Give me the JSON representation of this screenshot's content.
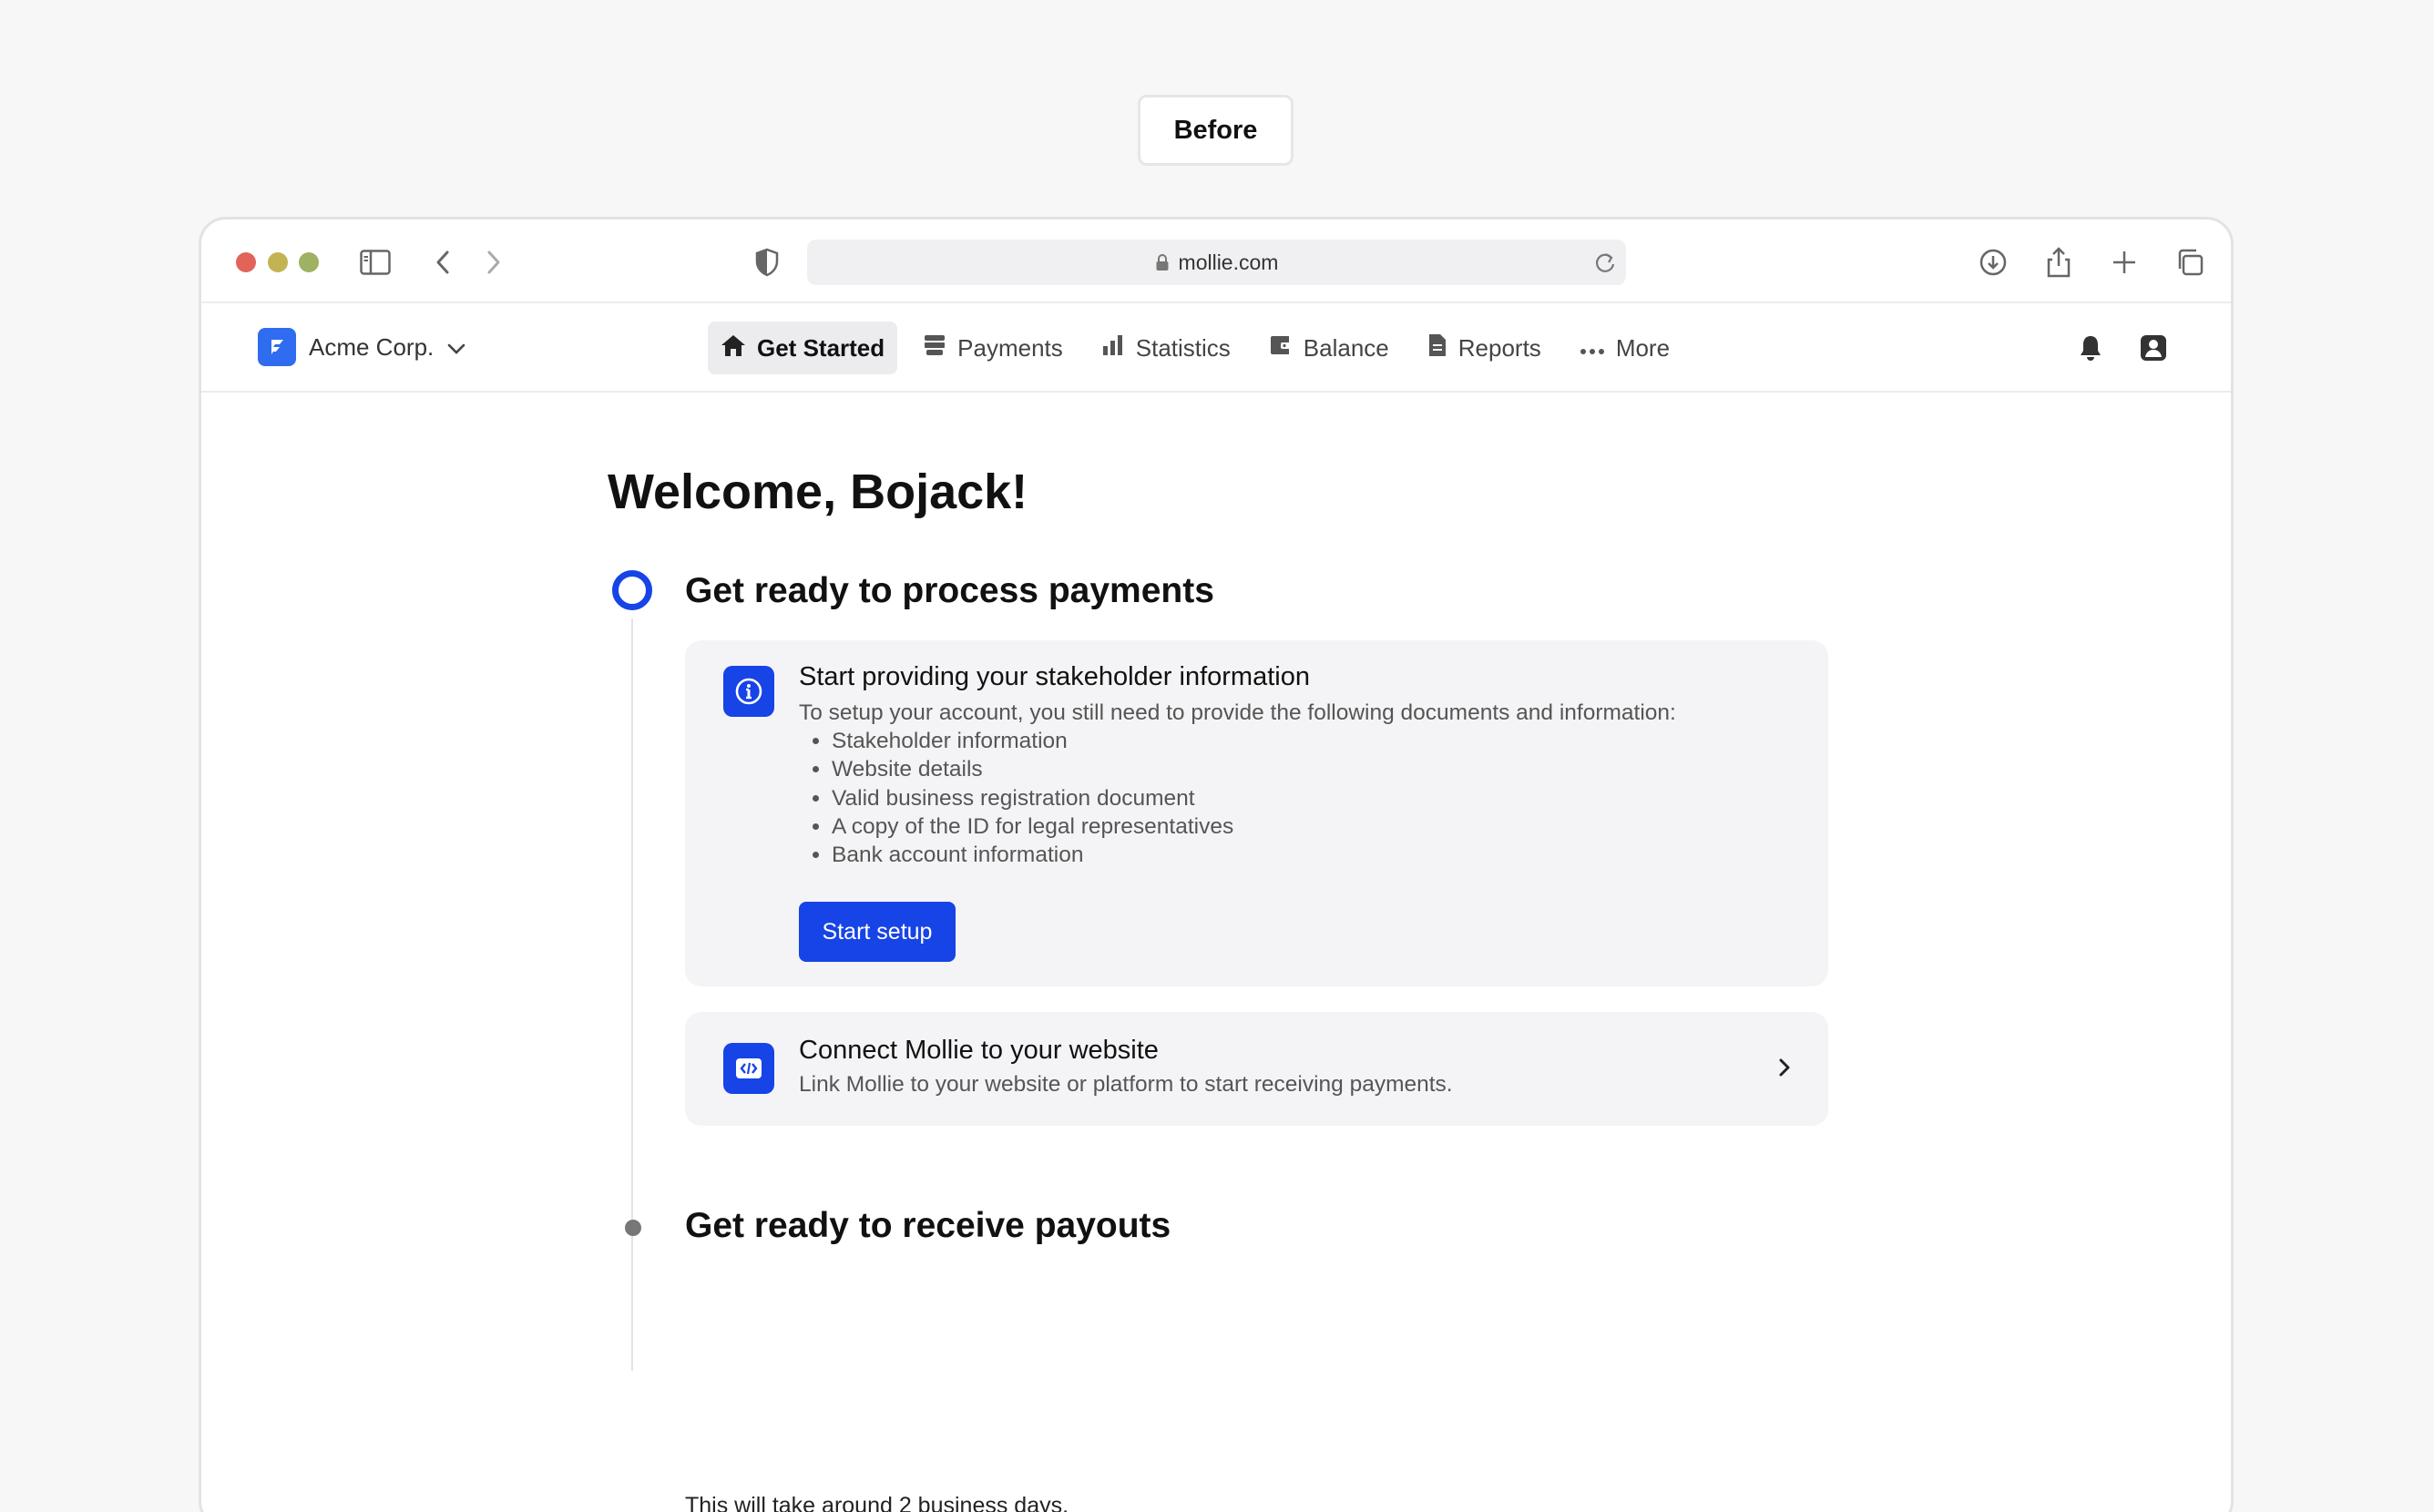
{
  "badge": {
    "label": "Before"
  },
  "browser": {
    "url": "mollie.com"
  },
  "appnav": {
    "org_name": "Acme Corp.",
    "links": [
      {
        "label": "Get Started",
        "icon": "home-icon",
        "active": true
      },
      {
        "label": "Payments",
        "icon": "payments-icon"
      },
      {
        "label": "Statistics",
        "icon": "bar-chart-icon"
      },
      {
        "label": "Balance",
        "icon": "wallet-icon"
      },
      {
        "label": "Reports",
        "icon": "document-icon"
      },
      {
        "label": "More",
        "icon": "more-dots-icon"
      }
    ]
  },
  "main": {
    "welcome": "Welcome, Bojack!",
    "section1": {
      "title": "Get ready to process payments",
      "card1": {
        "title": "Start providing your stakeholder information",
        "text": "To setup your account, you still need to provide the following documents and information:",
        "items": [
          "Stakeholder information",
          "Website details",
          "Valid business registration document",
          "A copy of the ID for legal representatives",
          "Bank account information"
        ],
        "button": "Start setup"
      },
      "card2": {
        "title": "Connect Mollie to your website",
        "text": "Link Mollie to your website or platform to start receiving payments."
      }
    },
    "section2": {
      "title": "Get ready to receive payouts",
      "note": "This will take around 2 business days."
    }
  },
  "colors": {
    "accent": "#1744e6",
    "background": "#f7f7f8"
  }
}
